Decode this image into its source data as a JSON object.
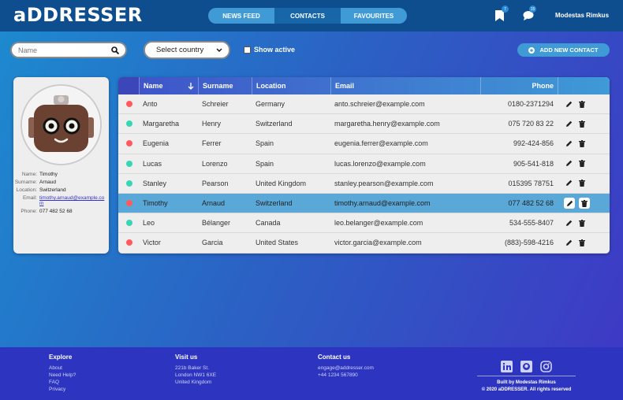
{
  "app": {
    "logo": "aDDRESSER",
    "user": "Modestas Rimkus"
  },
  "nav": {
    "items": [
      "NEWS FEED",
      "CONTACTS",
      "FAVOURITES"
    ],
    "active": 1
  },
  "badges": {
    "bookmarks": "7",
    "messages": "15"
  },
  "filters": {
    "search_placeholder": "Name",
    "country": "Select country",
    "show_active": "Show active",
    "add_contact": "ADD NEW CONTACT"
  },
  "selected": {
    "labels": {
      "name": "Name:",
      "surname": "Surname:",
      "location": "Location:",
      "email": "Email:",
      "phone": "Phone:"
    },
    "name": "Timothy",
    "surname": "Arnaud",
    "location": "Switzerland",
    "email": "timothy.arnaud@example.com",
    "phone": "077 482 52 68"
  },
  "table": {
    "headers": {
      "name": "Name",
      "surname": "Surname",
      "location": "Location",
      "email": "Email",
      "phone": "Phone"
    },
    "status_colors": {
      "active": "#37d6b4",
      "inactive": "#ff5a5f"
    },
    "rows": [
      {
        "name": "Anto",
        "surname": "Schreier",
        "location": "Germany",
        "email": "anto.schreier@example.com",
        "phone": "0180-2371294",
        "active": false
      },
      {
        "name": "Margaretha",
        "surname": "Henry",
        "location": "Switzerland",
        "email": "margaretha.henry@example.com",
        "phone": "075 720 83 22",
        "active": true
      },
      {
        "name": "Eugenia",
        "surname": "Ferrer",
        "location": "Spain",
        "email": "eugenia.ferrer@example.com",
        "phone": "992-424-856",
        "active": false
      },
      {
        "name": "Lucas",
        "surname": "Lorenzo",
        "location": "Spain",
        "email": "lucas.lorenzo@example.com",
        "phone": "905-541-818",
        "active": true
      },
      {
        "name": "Stanley",
        "surname": "Pearson",
        "location": "United Kingdom",
        "email": "stanley.pearson@example.com",
        "phone": "015395 78751",
        "active": true
      },
      {
        "name": "Timothy",
        "surname": "Arnaud",
        "location": "Switzerland",
        "email": "timothy.arnaud@example.com",
        "phone": "077 482 52 68",
        "active": false,
        "selected": true
      },
      {
        "name": "Leo",
        "surname": "Bélanger",
        "location": "Canada",
        "email": "leo.belanger@example.com",
        "phone": "534-555-8407",
        "active": true
      },
      {
        "name": "Victor",
        "surname": "Garcia",
        "location": "United States",
        "email": "victor.garcia@example.com",
        "phone": "(883)-598-4216",
        "active": false
      }
    ]
  },
  "footer": {
    "explore": {
      "title": "Explore",
      "links": [
        "About",
        "Need Help?",
        "FAQ",
        "Privacy"
      ]
    },
    "visit": {
      "title": "Visit us",
      "lines": [
        "221b Baker St.",
        "London NW1 6XE",
        "United Kingdom"
      ]
    },
    "contact": {
      "title": "Contact us",
      "lines": [
        "engage@addresser.com",
        "+44 1234 567890"
      ]
    },
    "built": "Built by Modestas Rimkus",
    "copyright": "© 2020 aDDRESSER. All rights reserved"
  }
}
